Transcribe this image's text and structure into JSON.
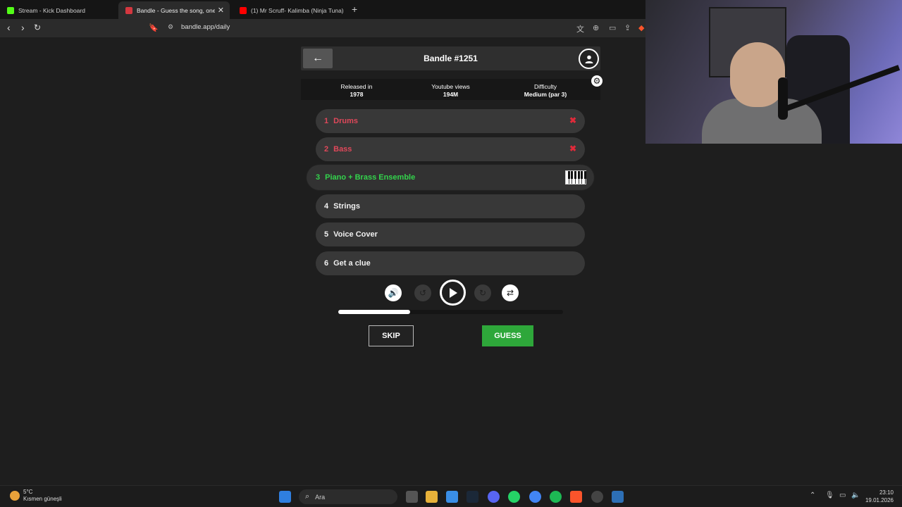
{
  "browser": {
    "tabs": [
      {
        "label": "Stream - Kick Dashboard",
        "favicon_color": "#53fc18",
        "active": false
      },
      {
        "label": "Bandle - Guess the song, one in",
        "favicon_color": "#d4373f",
        "active": true
      },
      {
        "label": "(1) Mr Scruff- Kalimba (Ninja Tuna) -",
        "favicon_color": "#ff0000",
        "active": false
      }
    ],
    "new_tab": "+",
    "url": "bandle.app/daily"
  },
  "game": {
    "title": "Bandle #1251",
    "info": {
      "released_label": "Released in",
      "released_value": "1978",
      "views_label": "Youtube views",
      "views_value": "194M",
      "difficulty_label": "Difficulty",
      "difficulty_value": "Medium (par 3)"
    },
    "stems": [
      {
        "num": "1",
        "label": "Drums",
        "state": "failed"
      },
      {
        "num": "2",
        "label": "Bass",
        "state": "failed"
      },
      {
        "num": "3",
        "label": "Piano + Brass Ensemble",
        "state": "active"
      },
      {
        "num": "4",
        "label": "Strings",
        "state": "locked"
      },
      {
        "num": "5",
        "label": "Voice Cover",
        "state": "locked"
      },
      {
        "num": "6",
        "label": "Get a clue",
        "state": "locked"
      }
    ],
    "progress_fraction": 0.32,
    "skip_label": "SKIP",
    "guess_label": "GUESS"
  },
  "taskbar": {
    "temperature": "5°C",
    "weather": "Kısmen güneşli",
    "search_placeholder": "Ara",
    "time": "23:10",
    "date": "19.01.2026"
  }
}
